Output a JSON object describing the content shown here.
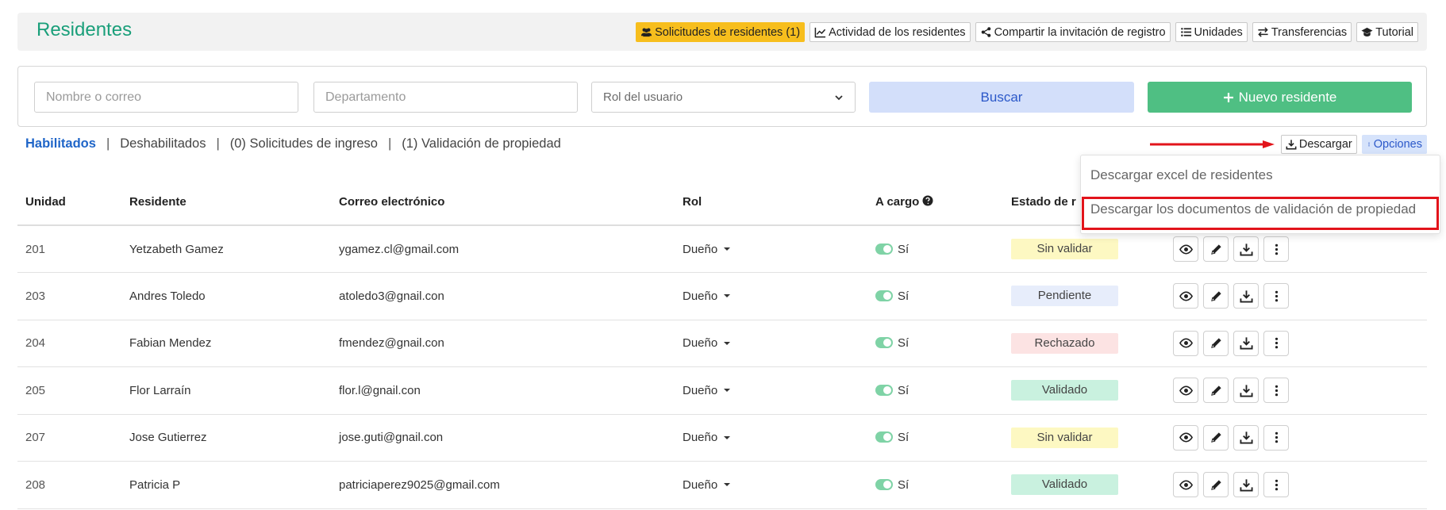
{
  "page": {
    "title": "Residentes"
  },
  "top_actions": [
    {
      "label": "Solicitudes de residentes (1)",
      "icon": "users-icon",
      "highlight": true
    },
    {
      "label": "Actividad de los residentes",
      "icon": "chart-line-icon"
    },
    {
      "label": "Compartir la invitación de registro",
      "icon": "share-icon"
    },
    {
      "label": "Unidades",
      "icon": "list-icon"
    },
    {
      "label": "Transferencias",
      "icon": "exchange-icon"
    },
    {
      "label": "Tutorial",
      "icon": "graduation-cap-icon"
    }
  ],
  "filters": {
    "name_placeholder": "Nombre o correo",
    "department_placeholder": "Departamento",
    "role_select_value": "Rol del usuario",
    "search_label": "Buscar",
    "new_resident_label": "Nuevo residente"
  },
  "tabs": {
    "enabled": "Habilitados",
    "disabled": "Deshabilitados",
    "requests": "(0) Solicitudes de ingreso",
    "validation": "(1) Validación de propiedad",
    "separator": "|"
  },
  "tools": {
    "download_label": "Descargar",
    "options_label": "Opciones"
  },
  "dropdown": {
    "item1": "Descargar excel de residentes",
    "item2": "Descargar los documentos de validación de propiedad"
  },
  "table": {
    "headers": {
      "unit": "Unidad",
      "resident": "Residente",
      "email": "Correo electrónico",
      "role": "Rol",
      "in_charge": "A cargo",
      "status": "Estado de r"
    },
    "rows": [
      {
        "unit": "201",
        "resident": "Yetzabeth Gamez",
        "email": "ygamez.cl@gmail.com",
        "role": "Dueño",
        "in_charge": "Sí",
        "status": "Sin validar",
        "status_color": "#fdf8c2"
      },
      {
        "unit": "203",
        "resident": "Andres Toledo",
        "email": "atoledo3@gnail.con",
        "role": "Dueño",
        "in_charge": "Sí",
        "status": "Pendiente",
        "status_color": "#e7edfb"
      },
      {
        "unit": "204",
        "resident": "Fabian Mendez",
        "email": "fmendez@gnail.con",
        "role": "Dueño",
        "in_charge": "Sí",
        "status": "Rechazado",
        "status_color": "#fce3e3"
      },
      {
        "unit": "205",
        "resident": "Flor Larraín",
        "email": "flor.l@gnail.con",
        "role": "Dueño",
        "in_charge": "Sí",
        "status": "Validado",
        "status_color": "#c9f1df"
      },
      {
        "unit": "207",
        "resident": "Jose Gutierrez",
        "email": "jose.guti@gnail.con",
        "role": "Dueño",
        "in_charge": "Sí",
        "status": "Sin validar",
        "status_color": "#fdf8c2"
      },
      {
        "unit": "208",
        "resident": "Patricia P",
        "email": "patriciaperez9025@gmail.com",
        "role": "Dueño",
        "in_charge": "Sí",
        "status": "Validado",
        "status_color": "#c9f1df"
      }
    ]
  },
  "colors": {
    "title": "#1a9f7a",
    "accent_yellow": "#f7be1d",
    "primary_green": "#4fbf83",
    "search_blue": "#d3dffa",
    "highlight_red": "#e2141b"
  }
}
